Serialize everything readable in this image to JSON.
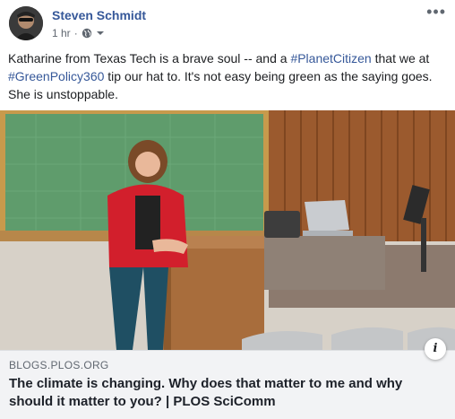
{
  "post": {
    "author": "Steven Schmidt",
    "timestamp": "1 hr",
    "separator": "·",
    "privacy_icon": "globe-icon",
    "menu_icon": "more-options-icon",
    "menu_glyph": "•••",
    "text_parts": [
      "Katharine from Texas Tech is a brave soul -- and a ",
      "#PlanetCitizen",
      " that we at ",
      "#GreenPolicy360",
      " tip our hat to. It's not easy being green as the saying goes. She is unstoppable."
    ]
  },
  "link_preview": {
    "domain": "BLOGS.PLOS.ORG",
    "title": "The climate is changing. Why does that matter to me and why should it matter to you? | PLOS SciComm",
    "info_icon": "info-icon",
    "info_glyph": "i"
  },
  "colors": {
    "link_blue": "#365899",
    "meta_gray": "#606770",
    "preview_bg": "#f2f3f5"
  }
}
